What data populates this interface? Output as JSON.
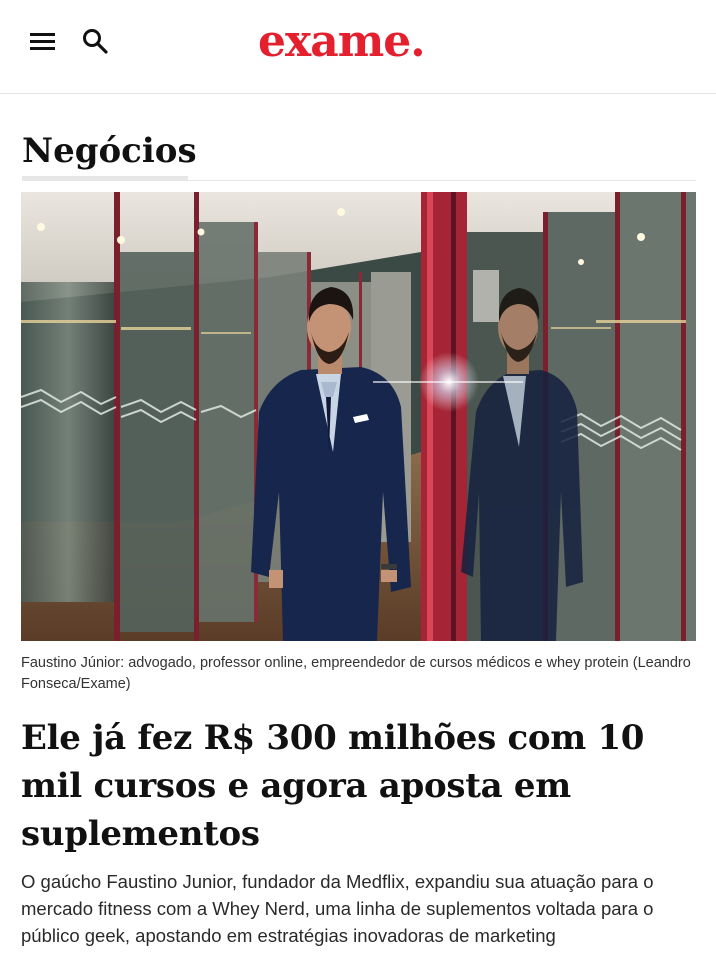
{
  "header": {
    "logo_text": "exame.",
    "menu_icon": "hamburger-menu-icon",
    "search_icon": "search-icon",
    "brand_color": "#e4202f"
  },
  "section": {
    "title": "Negócios"
  },
  "article": {
    "image_caption": "Faustino Júnior: advogado, professor online, empreendedor de cursos médicos e whey protein (Leandro Fonseca/Exame)",
    "headline": "Ele já fez R$ 300 milhões com 10 mil cursos e agora aposta em suplementos",
    "summary": "O gaúcho Faustino Junior, fundador da Medflix, expandiu sua atuação para o mercado fitness com a Whey Nerd, uma linha de suplementos voltada para o público geek, apostando em estratégias inovadoras de marketing"
  }
}
